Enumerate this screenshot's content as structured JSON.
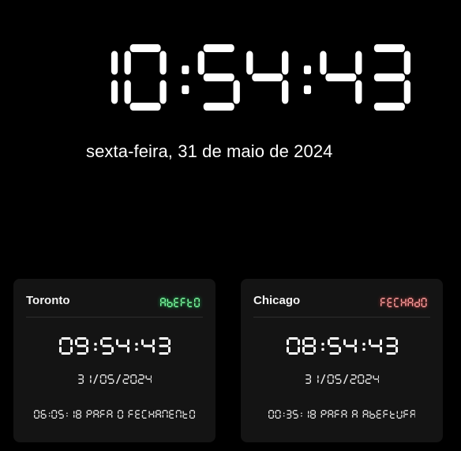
{
  "main_clock": {
    "time": "10:54:43",
    "date": "sexta-feira, 31 de maio de 2024"
  },
  "markets": [
    {
      "city": "Toronto",
      "status": "ABERTO",
      "status_color": "#7dffa1",
      "status_glow": "#1fe064",
      "time": "09:54:43",
      "date": "31/05/2024",
      "countdown": "06:05:18 PARA O FECHAMENTO"
    },
    {
      "city": "Chicago",
      "status": "FECHADO",
      "status_color": "#ff9d9d",
      "status_glow": "#e03c3c",
      "time": "08:54:43",
      "date": "31/05/2024",
      "countdown": "00:35:18 PARA A ABERTURA"
    }
  ],
  "colors": {
    "background": "#000000",
    "card_background": "#141414",
    "text": "#ffffff"
  }
}
